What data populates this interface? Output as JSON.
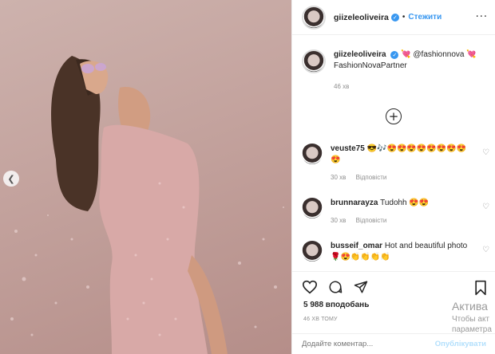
{
  "post": {
    "username": "giizeleoliveira",
    "follow_label": "Стежити",
    "more_label": "···",
    "verified_glyph": "✓"
  },
  "caption": {
    "username": "giizeleoliveira",
    "text": "💘 @fashionnova 💘",
    "tag": "FashionNovaPartner",
    "time": "46 хв"
  },
  "load_more_label": "+",
  "comments": [
    {
      "username": "veuste75",
      "text": "😎🎶😍😍😍😍😍😍😍😍😍",
      "time": "30 хв",
      "reply": "Відповісти"
    },
    {
      "username": "brunnarayza",
      "text": "Tudohh 😍😍",
      "time": "30 хв",
      "reply": "Відповісти"
    },
    {
      "username": "busseif_omar",
      "text": "Hot and beautiful photo 🌹😍👏👏👏👏",
      "time": "",
      "reply": ""
    }
  ],
  "likes": "5 988 вподобань",
  "timestamp": "46 ХВ ТОМУ",
  "composer": {
    "placeholder": "Додайте коментар...",
    "publish": "Опублікувати"
  },
  "watermark": {
    "line1": "Актива",
    "line2": "Чтобы акт",
    "line3": "параметра"
  },
  "icons": {
    "prev": "chevron-left-icon",
    "more": "more-options-icon",
    "like": "heart-icon",
    "comment": "comment-icon",
    "share": "share-icon",
    "save": "bookmark-icon"
  },
  "colors": {
    "link": "#3897f0",
    "muted": "#8e8e8e",
    "publish_disabled": "#b2dffc"
  }
}
